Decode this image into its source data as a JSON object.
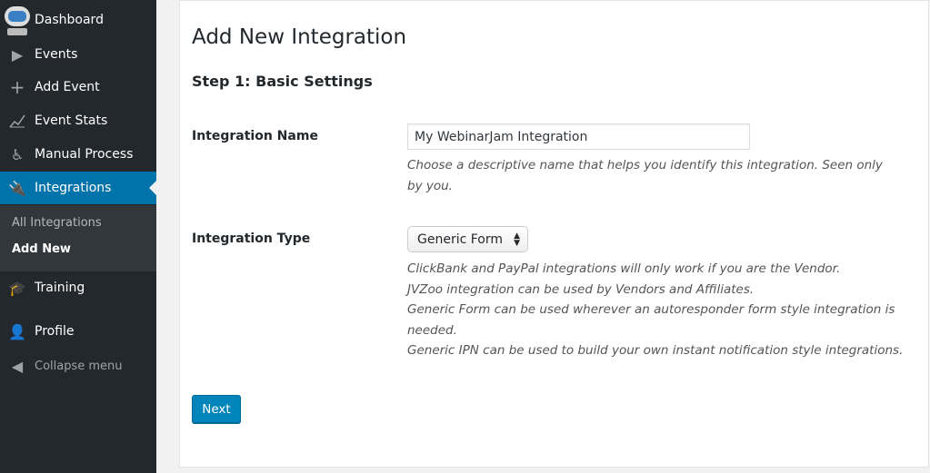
{
  "sidebar": {
    "items": [
      {
        "label": "Dashboard",
        "icon": "robot-logo-icon"
      },
      {
        "label": "Events",
        "icon": "video-play-icon"
      },
      {
        "label": "Add Event",
        "icon": "plus-icon"
      },
      {
        "label": "Event Stats",
        "icon": "chart-line-icon"
      },
      {
        "label": "Manual Process",
        "icon": "universal-access-icon"
      },
      {
        "label": "Integrations",
        "icon": "plug-icon"
      },
      {
        "label": "Training",
        "icon": "graduation-cap-icon"
      },
      {
        "label": "Profile",
        "icon": "user-icon"
      },
      {
        "label": "Collapse menu",
        "icon": "collapse-arrow-icon"
      }
    ],
    "submenu": [
      {
        "label": "All Integrations"
      },
      {
        "label": "Add New"
      }
    ]
  },
  "main": {
    "title": "Add New Integration",
    "step": "Step 1: Basic Settings",
    "name_label": "Integration Name",
    "name_value": "My WebinarJam Integration",
    "name_desc": "Choose a descriptive name that helps you identify this integration. Seen only by you.",
    "type_label": "Integration Type",
    "type_value": "Generic Form",
    "type_desc": [
      "ClickBank and PayPal integrations will only work if you are the Vendor.",
      "JVZoo integration can be used by Vendors and Affiliates.",
      "Generic Form can be used wherever an autoresponder form style integration is needed.",
      "Generic IPN can be used to build your own instant notification style integrations."
    ],
    "next_label": "Next"
  },
  "colors": {
    "sidebar": "#23282d",
    "accent": "#0073aa",
    "button": "#0085ba"
  }
}
